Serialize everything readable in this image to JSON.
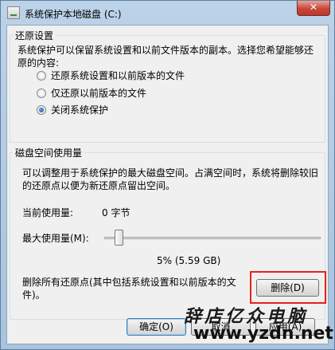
{
  "window": {
    "title": "系统保护本地磁盘 (C:)",
    "close_label": "✕"
  },
  "restore_settings": {
    "group_title": "还原设置",
    "description": "系统保护可以保留系统设置和以前文件版本的副本。选择您希望能够还原的内容:",
    "options": [
      {
        "label": "还原系统设置和以前版本的文件",
        "checked": false
      },
      {
        "label": "仅还原以前版本的文件",
        "checked": false
      },
      {
        "label": "关闭系统保护",
        "checked": true
      }
    ]
  },
  "disk_usage": {
    "group_title": "磁盘空间使用量",
    "description": "可以调整用于系统保护的最大磁盘空间。占满空间时，系统将删除较旧的还原点以便为新还原点留出空间。",
    "current_label": "当前使用量:",
    "current_value": "0 字节",
    "max_label": "最大使用量(M):",
    "max_value_text": "5% (5.59 GB)",
    "max_percent": 5,
    "delete_description": "删除所有还原点(其中包括系统设置和以前版本的文件)。",
    "delete_button": "删除(D)"
  },
  "footer": {
    "ok_button": "确定(O)",
    "cancel_button": "取消",
    "apply_button": "应用(A)"
  },
  "watermark": {
    "chinese": "辞店亿众电脑",
    "url": "www.yzdn.net"
  },
  "colors": {
    "highlight": "#e4211b",
    "close": "#c8473a"
  }
}
